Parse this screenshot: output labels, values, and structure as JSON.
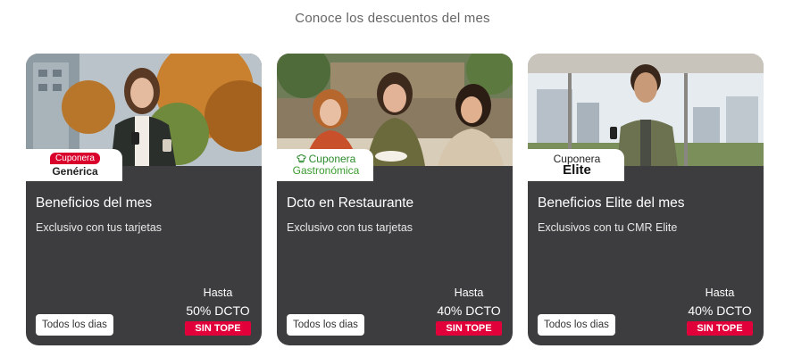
{
  "section": {
    "title": "Conoce los descuentos del mes"
  },
  "cards": [
    {
      "badge_top": "Cuponera",
      "badge_bottom": "Genérica",
      "title": "Beneficios del mes",
      "subtitle": "Exclusivo con tus tarjetas",
      "days_label": "Todos los dias",
      "deal_upto": "Hasta",
      "deal_value": "50% DCTO",
      "deal_tag": "SIN TOPE",
      "photo": "woman-with-phone-and-coffee-photo"
    },
    {
      "badge_top": "Cuponera",
      "badge_bottom": "Gastronómica",
      "title": "Dcto en Restaurante",
      "subtitle": "Exclusivo con tus tarjetas",
      "days_label": "Todos los dias",
      "deal_upto": "Hasta",
      "deal_value": "40% DCTO",
      "deal_tag": "SIN TOPE",
      "photo": "friends-at-restaurant-photo"
    },
    {
      "badge_top": "Cuponera",
      "badge_bottom": "Elite",
      "title": "Beneficios Elite del mes",
      "subtitle": "Exclusivos con tu CMR Elite",
      "days_label": "Todos los dias",
      "deal_upto": "Hasta",
      "deal_value": "40% DCTO",
      "deal_tag": "SIN TOPE",
      "photo": "man-with-phone-by-window-photo"
    }
  ],
  "colors": {
    "card_bg": "#3d3d3f",
    "accent_red": "#e1003a",
    "gastronomy_green": "#3a9b2e"
  }
}
